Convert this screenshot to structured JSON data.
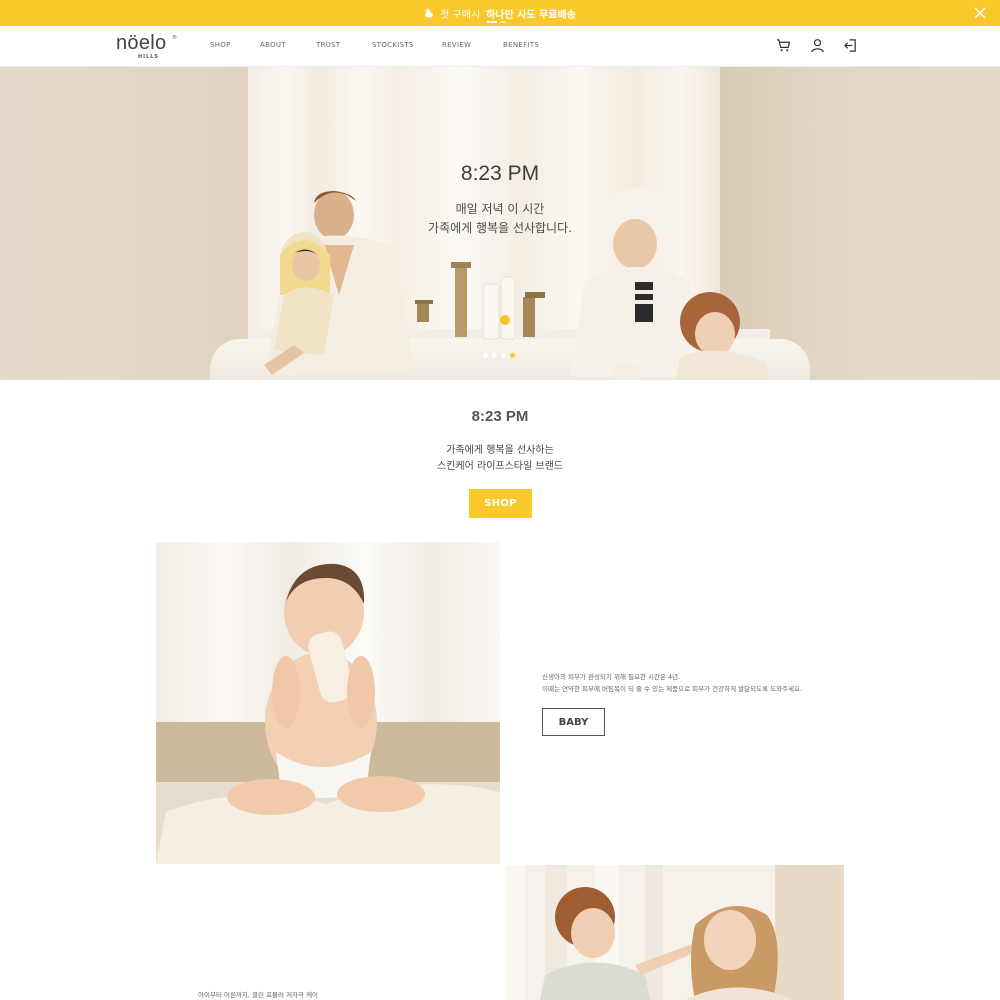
{
  "promo": {
    "text_prefix": "첫 구매시",
    "text_bold": "하나만 사도 무료배송",
    "accent_color": "#f9c82a"
  },
  "header": {
    "logo": "nöelo",
    "logo_sub": "HILLS",
    "nav": [
      "SHOP",
      "ABOUT",
      "TRUST",
      "STOCKISTS",
      "REVIEW",
      "BENEFITS"
    ],
    "icons": [
      "cart-icon",
      "user-icon",
      "logout-icon"
    ]
  },
  "hero": {
    "time": "8:23 PM",
    "line1": "매일 저녁 이 시간",
    "line2": "가족에게 행복을 선사합니다.",
    "slide_count": 4,
    "active_slide": 4
  },
  "intro": {
    "time": "8:23 PM",
    "line1": "가족에게 행복을 선사하는",
    "line2": "스킨케어 라이프스타일 브랜드",
    "shop_button": "SHOP"
  },
  "baby_section": {
    "desc1": "신생아의 피부가 완성되기 위해 필요한 시간은 4년.",
    "desc2": "이때는 연약한 피부에 버팀목이 되 줄 수 있는 제품으로 피부가 건강하게 발달되도록 도와주세요.",
    "button": "BABY"
  },
  "kids_section": {
    "desc1": "아이부터 어른까지, 클린 포뮬러 저자극 케어"
  }
}
